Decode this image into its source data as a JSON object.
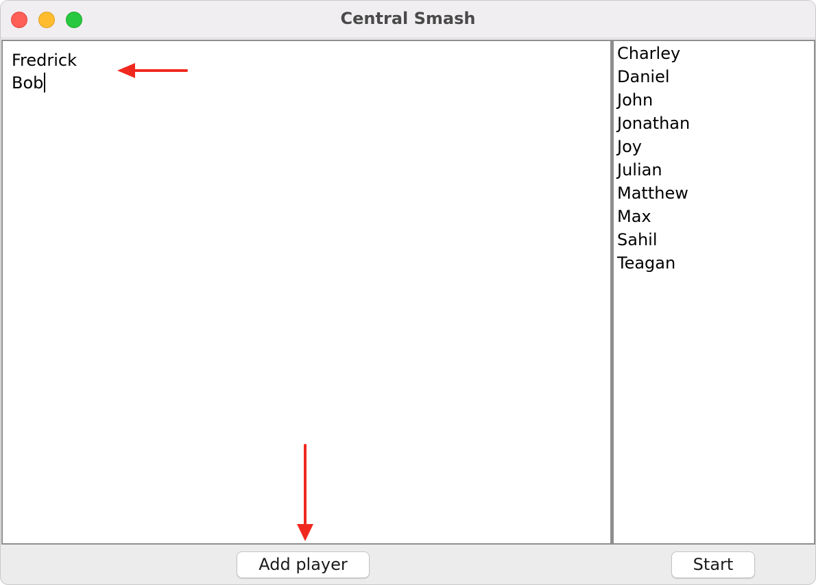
{
  "window": {
    "title": "Central Smash"
  },
  "text_area": {
    "lines": [
      "Fredrick",
      "Bob"
    ]
  },
  "player_list": {
    "items": [
      "Charley",
      "Daniel",
      "John",
      "Jonathan",
      "Joy",
      "Julian",
      "Matthew",
      "Max",
      "Sahil",
      "Teagan"
    ]
  },
  "buttons": {
    "add_player": "Add player",
    "start": "Start"
  },
  "annotations": {
    "arrow_color": "#f0291f"
  },
  "colors": {
    "close": "#fe5f57",
    "minimize": "#febc2e",
    "zoom": "#28c840"
  }
}
